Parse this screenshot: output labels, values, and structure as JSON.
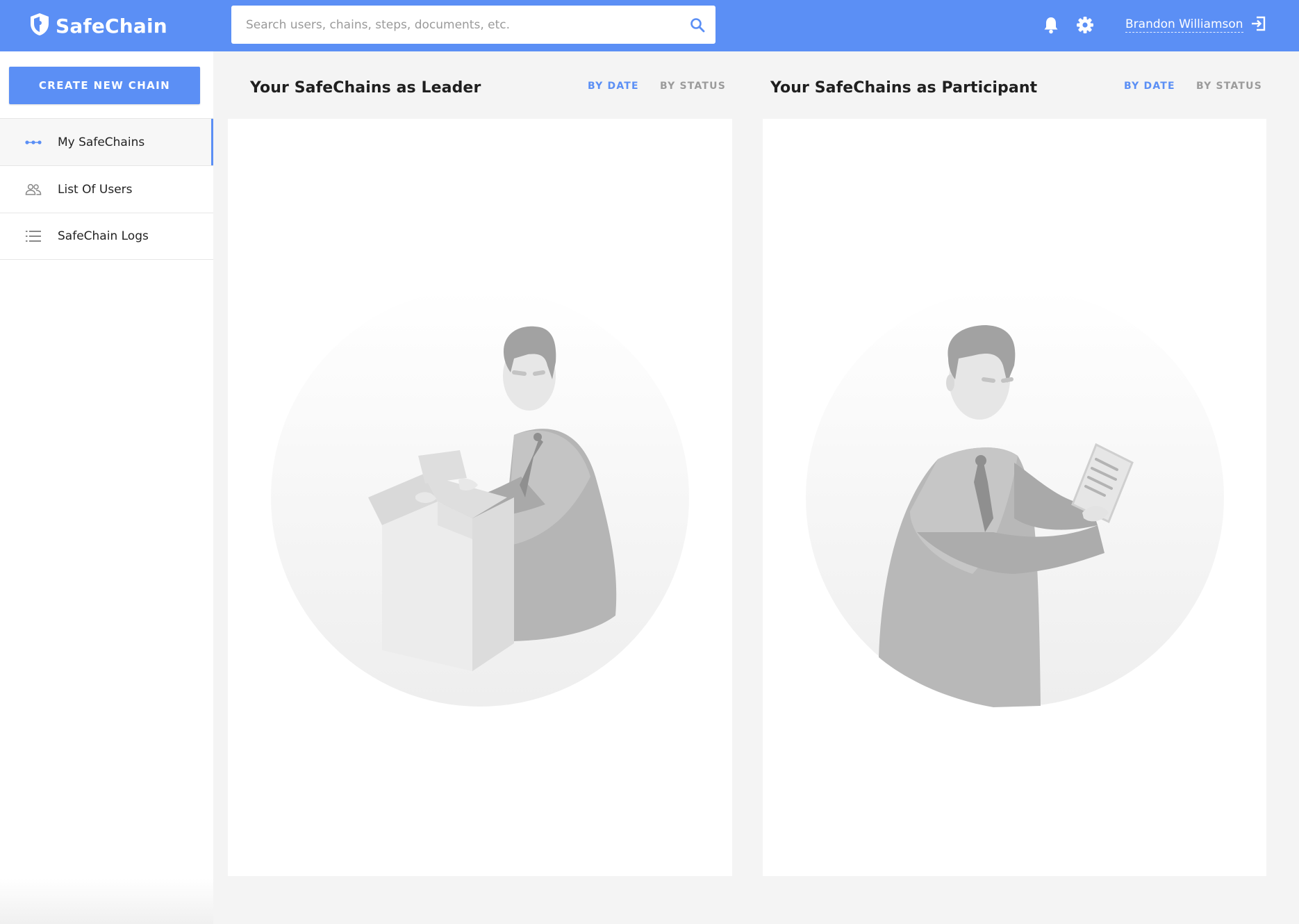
{
  "app": {
    "brand_name": "SafeChain",
    "brand_color": "#5b8ff5"
  },
  "search": {
    "placeholder": "Search users, chains, steps, documents, etc."
  },
  "header": {
    "user_name": "Brandon Williamson",
    "icons": [
      "bell-icon",
      "gear-icon",
      "logout-icon"
    ]
  },
  "sidebar": {
    "create_label": "CREATE NEW CHAIN",
    "items": [
      {
        "label": "My SafeChains",
        "icon": "chain-dots-icon",
        "active": true
      },
      {
        "label": "List Of Users",
        "icon": "users-icon",
        "active": false
      },
      {
        "label": "SafeChain Logs",
        "icon": "list-icon",
        "active": false
      }
    ]
  },
  "main": {
    "leader": {
      "title": "Your SafeChains as Leader",
      "sort_date": "BY DATE",
      "sort_status": "BY STATUS"
    },
    "participant": {
      "title": "Your SafeChains as Participant",
      "sort_date": "BY DATE",
      "sort_status": "BY STATUS"
    }
  }
}
